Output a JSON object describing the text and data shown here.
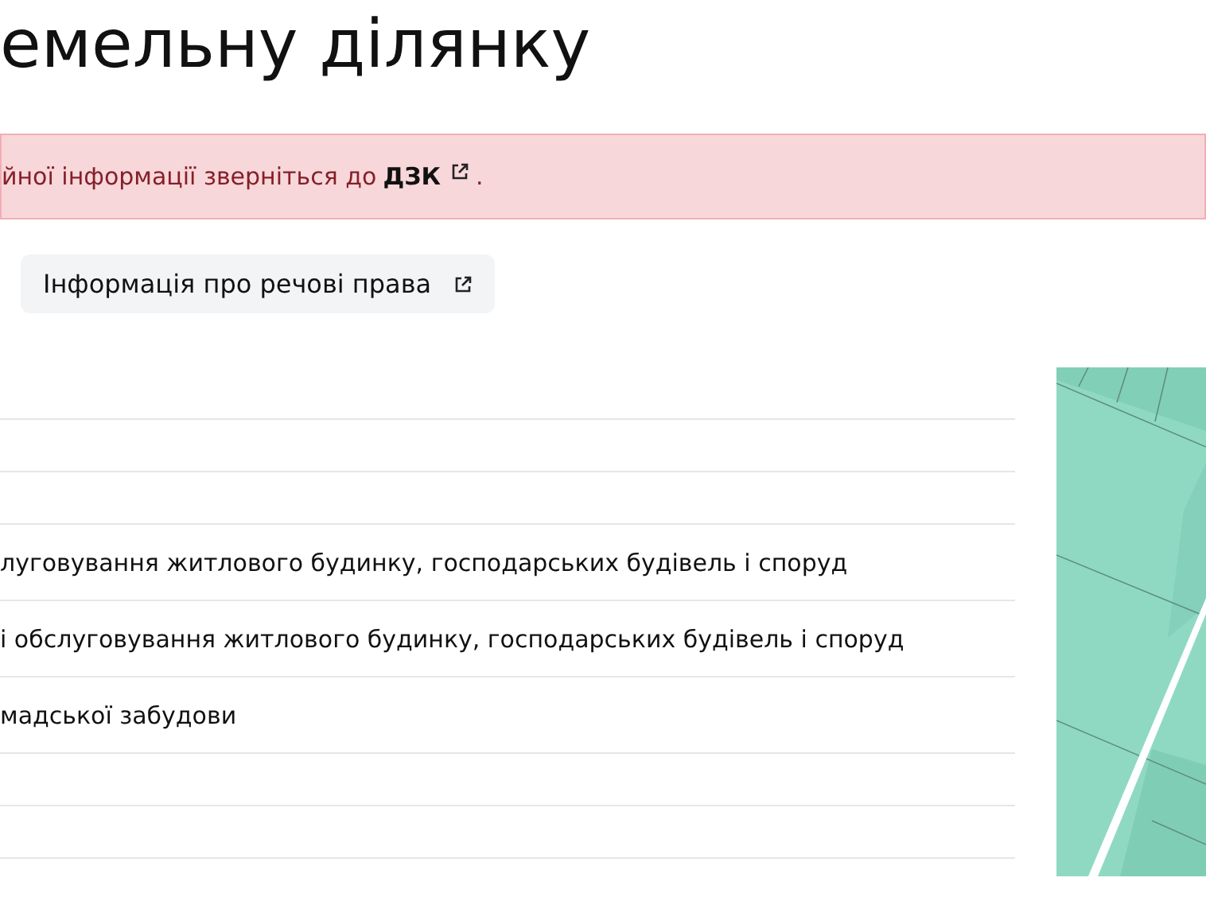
{
  "heading": "емельну ділянку",
  "alert": {
    "text": "йної інформації зверніться до",
    "link": "ДЗК",
    "after": "."
  },
  "rights_button": {
    "label": "Інформація про речові права"
  },
  "table": {
    "rows": [
      {},
      {},
      {},
      {
        "value": "луговування житлового будинку, господарських будівель і споруд"
      },
      {
        "value": "і обслуговування житлового будинку, господарських будівель і споруд"
      },
      {
        "value": "мадської забудови"
      },
      {},
      {}
    ]
  }
}
